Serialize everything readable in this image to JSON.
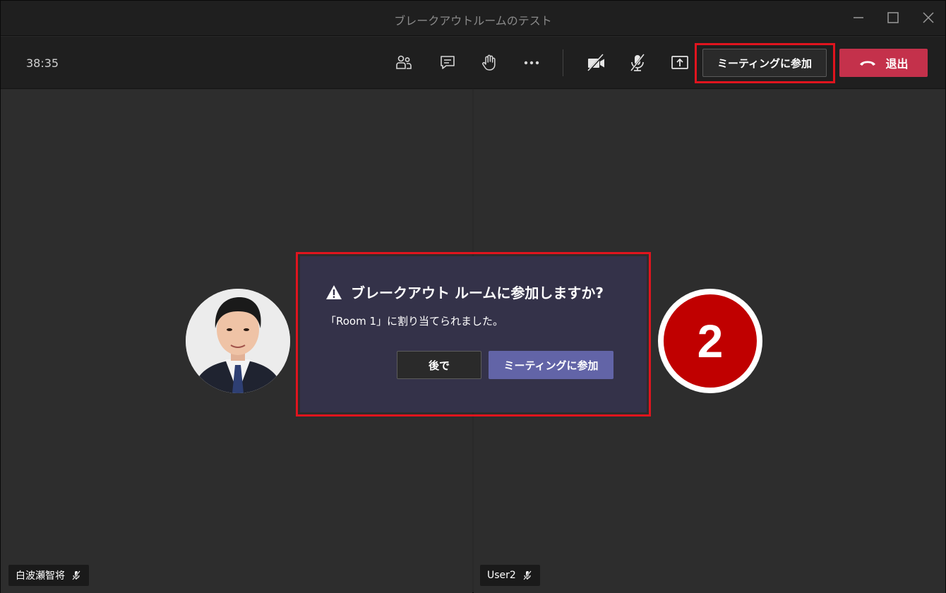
{
  "window": {
    "title": "ブレークアウトルームのテスト"
  },
  "toolbar": {
    "timer": "38:35",
    "join_meeting_label": "ミーティングに参加",
    "leave_label": "退出",
    "icons": [
      "participants-icon",
      "chat-icon",
      "raise-hand-icon",
      "more-options-icon",
      "camera-off-icon",
      "mic-off-icon",
      "share-screen-icon",
      "hang-up-icon"
    ]
  },
  "participants": [
    {
      "name": "白波瀬智将",
      "muted": true
    },
    {
      "name": "User2",
      "muted": true,
      "avatar_badge": "2"
    }
  ],
  "dialog": {
    "title": "ブレークアウト ルームに参加しますか?",
    "message": "「Room 1」に割り当てられました。",
    "later_label": "後で",
    "join_label": "ミーティングに参加"
  },
  "colors": {
    "highlight": "#e0141e",
    "leave": "#c4314b",
    "primary": "#6264a7",
    "dialog_bg": "#343249",
    "badge": "#c00000"
  }
}
